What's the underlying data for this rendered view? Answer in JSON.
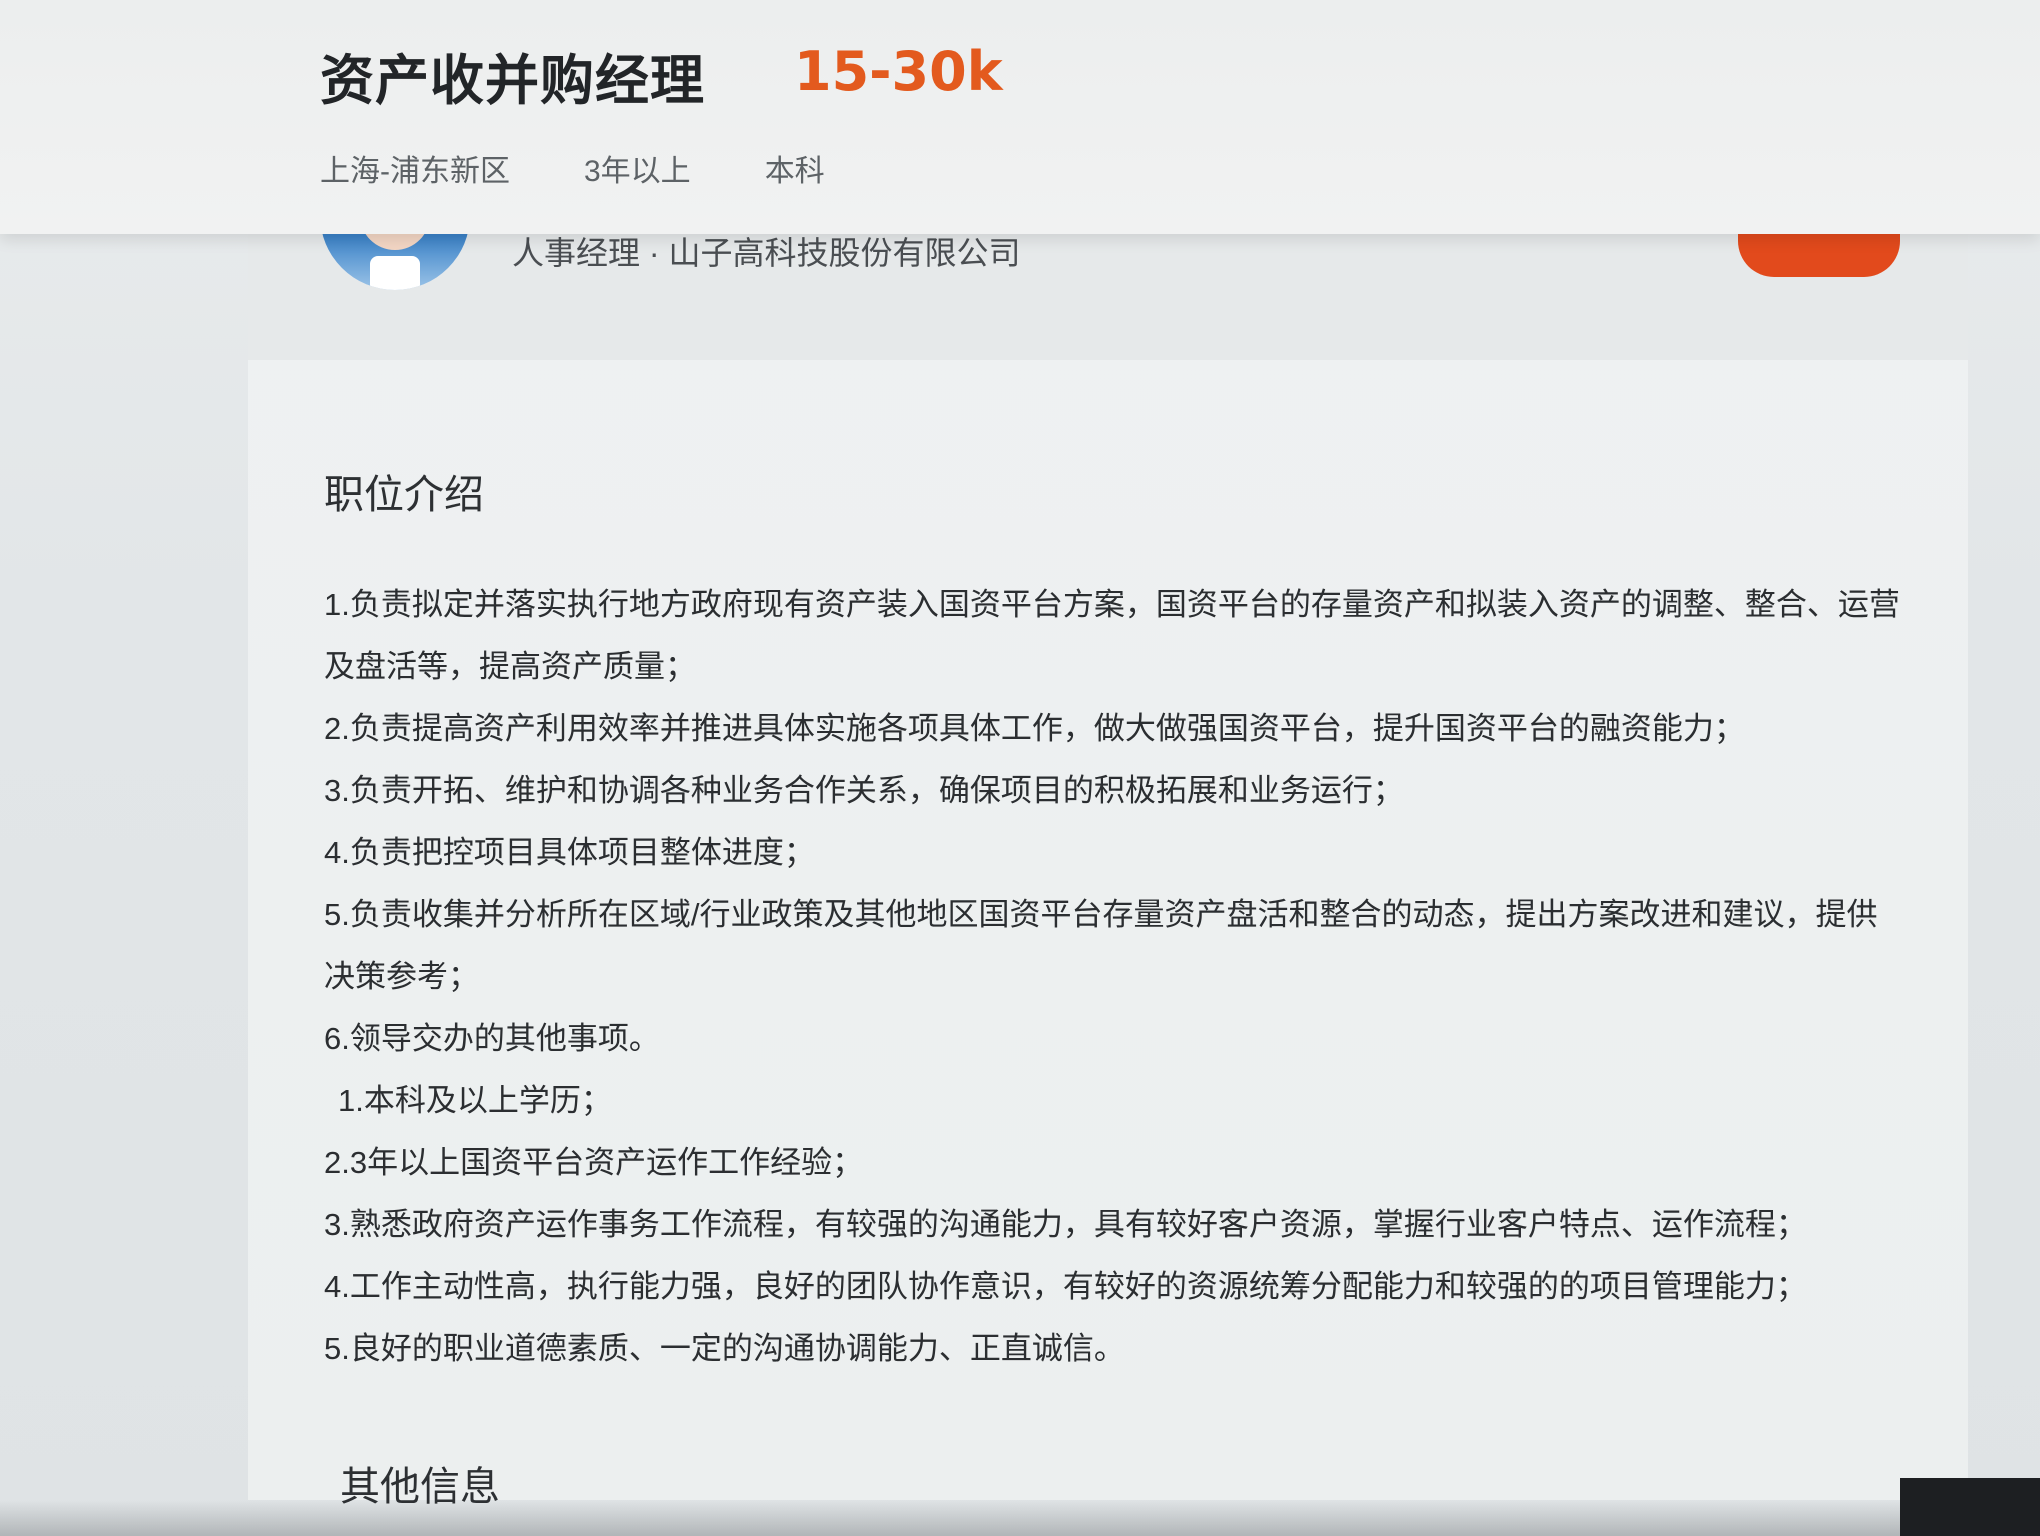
{
  "header": {
    "job_title": "资产收并购经理",
    "salary": "15-30k",
    "location": "上海-浦东新区",
    "experience": "3年以上",
    "education": "本科"
  },
  "recruiter": {
    "info": "人事经理 · 山子高科技股份有限公司"
  },
  "job_description": {
    "section_title": "职位介绍",
    "lines": [
      "1.负责拟定并落实执行地方政府现有资产装入国资平台方案，国资平台的存量资产和拟装入资产的调整、整合、运营及盘活等，提高资产质量；",
      "2.负责提高资产利用效率并推进具体实施各项具体工作，做大做强国资平台，提升国资平台的融资能力；",
      "3.负责开拓、维护和协调各种业务合作关系，确保项目的积极拓展和业务运行；",
      "4.负责把控项目具体项目整体进度；",
      "5.负责收集并分析所在区域/行业政策及其他地区国资平台存量资产盘活和整合的动态，提出方案改进和建议，提供决策参考；",
      "6.领导交办的其他事项。",
      "1.本科及以上学历；",
      "2.3年以上国资平台资产运作工作经验；",
      "3.熟悉政府资产运作事务工作流程，有较强的沟通能力，具有较好客户资源，掌握行业客户特点、运作流程；",
      "4.工作主动性高，执行能力强，良好的团队协作意识，有较好的资源统筹分配能力和较强的的项目管理能力；",
      "5.良好的职业道德素质、一定的沟通协调能力、正直诚信。"
    ]
  },
  "other_info": {
    "section_title": "其他信息"
  }
}
